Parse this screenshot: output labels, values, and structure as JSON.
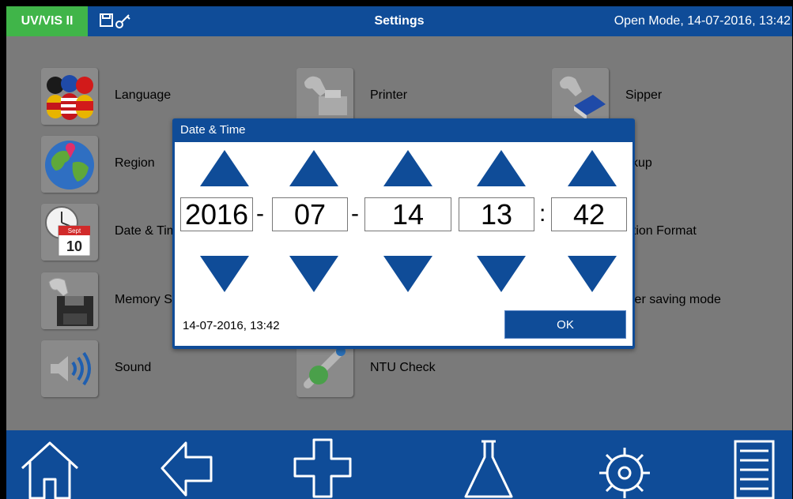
{
  "header": {
    "app_badge": "UV/VIS II",
    "title": "Settings",
    "mode_datetime": "Open Mode, 14-07-2016, 13:42",
    "status_icons": [
      "save-icon",
      "key-icon"
    ]
  },
  "settings": {
    "language": "Language",
    "region": "Region",
    "date_time": "Date & Tim",
    "memory_settings": "Memory Se",
    "sound": "Sound",
    "printer": "Printer",
    "ntu_check": "NTU Check",
    "sipper": "Sipper",
    "backup": "ckup",
    "solution_format": "ution Format",
    "power_saving": "wer saving mode"
  },
  "calendar_tile": {
    "month": "Sept",
    "day": "10"
  },
  "dialog": {
    "title": "Date & Time",
    "year": "2016",
    "month": "07",
    "day": "14",
    "hour": "13",
    "minute": "42",
    "separator_date": "-",
    "separator_time": ":",
    "summary": "14-07-2016, 13:42",
    "ok_label": "OK"
  },
  "nav": [
    "home-icon",
    "back-icon",
    "add-icon",
    "flask-icon",
    "gear-icon",
    "list-icon"
  ],
  "colors": {
    "primary_blue": "#0f4c98",
    "badge_green": "#40b549",
    "background_gray": "#7a7a7a"
  }
}
